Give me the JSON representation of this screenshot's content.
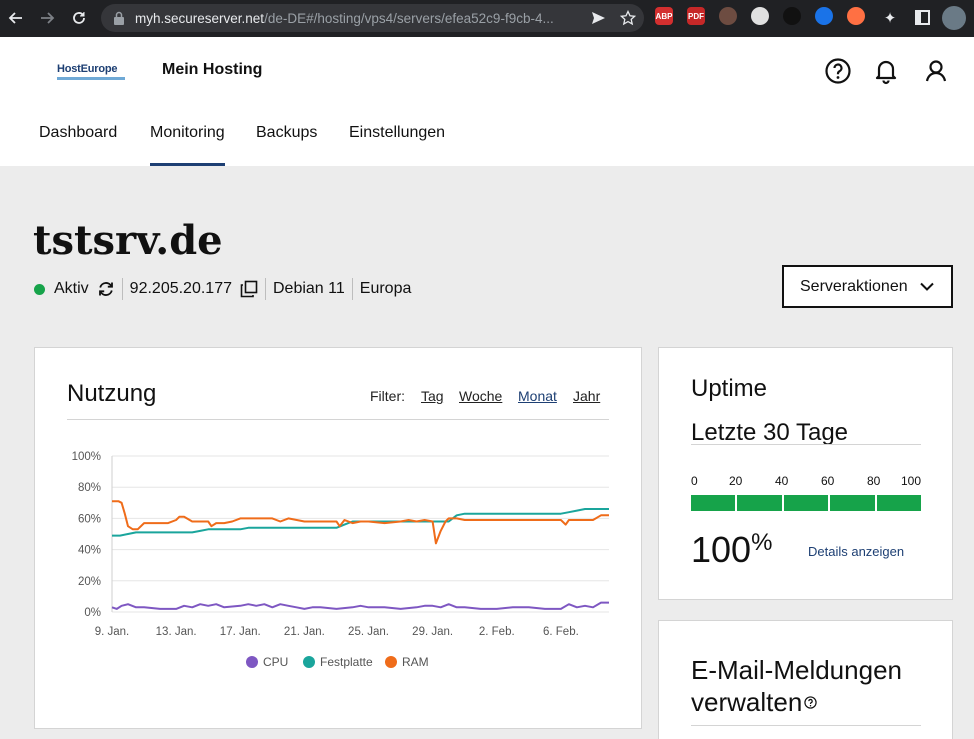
{
  "browser": {
    "url_host": "myh.secureserver.net",
    "url_path": "/de-DE#/hosting/vps4/servers/efea52c9-f9cb-4...",
    "extensions": [
      {
        "name": "abp-extension",
        "label": "ABP",
        "color": "#d32f2f"
      },
      {
        "name": "pdf-extension",
        "label": "PDF",
        "color": "#c62828"
      },
      {
        "name": "coffee-extension",
        "label": "",
        "color": "#6d4c41"
      },
      {
        "name": "media-extension",
        "label": "",
        "color": "#e0e0e0"
      },
      {
        "name": "gnome-extension",
        "label": "",
        "color": "#111111"
      },
      {
        "name": "shield-extension",
        "label": "",
        "color": "#1a73e8"
      },
      {
        "name": "drop-extension",
        "label": "",
        "color": "#ff7043"
      }
    ]
  },
  "header": {
    "logo_text": "HostEurope",
    "site_name": "Mein Hosting",
    "tabs": [
      {
        "label": "Dashboard",
        "active": false
      },
      {
        "label": "Monitoring",
        "active": true
      },
      {
        "label": "Backups",
        "active": false
      },
      {
        "label": "Einstellungen",
        "active": false
      }
    ]
  },
  "server": {
    "name": "tstsrv.de",
    "status": "Aktiv",
    "ip": "92.205.20.177",
    "os": "Debian 11",
    "region": "Europa",
    "actions_label": "Serveraktionen",
    "status_color": "#16a34a"
  },
  "usage": {
    "title": "Nutzung",
    "filter_label": "Filter:",
    "filters": [
      {
        "label": "Tag",
        "active": false
      },
      {
        "label": "Woche",
        "active": false
      },
      {
        "label": "Monat",
        "active": true
      },
      {
        "label": "Jahr",
        "active": false
      }
    ]
  },
  "chart_data": {
    "type": "line",
    "title": "",
    "xlabel": "",
    "ylabel": "",
    "ylim": [
      0,
      100
    ],
    "y_ticks": [
      "0%",
      "20%",
      "40%",
      "60%",
      "80%",
      "100%"
    ],
    "x_ticks": [
      "9. Jan.",
      "13. Jan.",
      "17. Jan.",
      "21. Jan.",
      "25. Jan.",
      "29. Jan.",
      "2. Feb.",
      "6. Feb."
    ],
    "x_tick_days": [
      0,
      4,
      8,
      12,
      16,
      20,
      24,
      28
    ],
    "x_range_days": [
      0,
      31
    ],
    "grid": "horizontal",
    "legend_position": "bottom",
    "series": [
      {
        "name": "CPU",
        "color": "#7e57c2",
        "x": [
          0,
          0.3,
          0.6,
          1,
          1.5,
          2,
          3,
          4,
          4.5,
          5,
          5.5,
          6,
          6.5,
          7,
          8,
          8.5,
          9,
          9.5,
          10,
          10.5,
          11,
          11.5,
          12,
          12.5,
          13,
          14,
          15,
          15.5,
          16,
          17,
          18,
          19,
          19.5,
          20,
          20.5,
          21,
          21.5,
          22,
          23,
          24,
          25,
          26,
          27,
          28,
          28.5,
          29,
          29.5,
          30,
          30.5,
          31
        ],
        "y": [
          3,
          2,
          4,
          5,
          3,
          3,
          2,
          2,
          4,
          3,
          5,
          4,
          5,
          3,
          4,
          5,
          4,
          5,
          3,
          5,
          4,
          3,
          2,
          3,
          3,
          2,
          3,
          4,
          3,
          3,
          2,
          3,
          4,
          4,
          3,
          5,
          3,
          3,
          2,
          2,
          3,
          3,
          2,
          2,
          5,
          3,
          4,
          3,
          6,
          6
        ]
      },
      {
        "name": "Festplatte",
        "color": "#1aa59c",
        "x": [
          0,
          0.5,
          1,
          1.5,
          2,
          4,
          5,
          5.5,
          6,
          7,
          8,
          8.5,
          9,
          14,
          14.5,
          15,
          16,
          18,
          19,
          20,
          21,
          21.5,
          22,
          28,
          28.5,
          29,
          29.5,
          30,
          31
        ],
        "y": [
          49,
          49,
          50,
          51,
          51,
          51,
          51,
          52,
          53,
          53,
          53,
          54,
          54,
          54,
          56,
          58,
          58,
          58,
          58,
          58,
          58,
          62,
          63,
          63,
          64,
          65,
          66,
          66,
          66
        ]
      },
      {
        "name": "RAM",
        "color": "#ef6c1a",
        "x": [
          0,
          0.4,
          0.6,
          0.8,
          1,
          1.3,
          1.6,
          2,
          3,
          3.5,
          4,
          4.2,
          4.5,
          5,
          6,
          6.2,
          6.5,
          7,
          7.5,
          8,
          8.5,
          10,
          10.5,
          11,
          12,
          14,
          14.2,
          14.5,
          15,
          15.5,
          16,
          17,
          18,
          18.5,
          19,
          19.5,
          20,
          20.2,
          20.5,
          20.8,
          21,
          21.5,
          22,
          28,
          28.3,
          28.5,
          29,
          30,
          30.5,
          31
        ],
        "y": [
          71,
          71,
          70,
          63,
          55,
          53,
          53,
          57,
          57,
          57,
          59,
          61,
          61,
          58,
          58,
          55,
          57,
          57,
          58,
          60,
          60,
          60,
          58,
          60,
          58,
          58,
          55,
          59,
          57,
          58,
          58,
          57,
          58,
          59,
          58,
          59,
          58,
          44,
          52,
          58,
          60,
          60,
          59,
          59,
          56,
          59,
          59,
          59,
          62,
          62
        ]
      }
    ]
  },
  "uptime": {
    "title": "Uptime",
    "subtitle": "Letzte 30 Tage",
    "scale": [
      "0",
      "20",
      "40",
      "60",
      "80",
      "100"
    ],
    "value": "100",
    "unit": "%",
    "bar_fill_percent": 100,
    "bar_color": "#16a34a",
    "details_label": "Details anzeigen"
  },
  "email": {
    "title": "E-Mail-Meldungen verwalten"
  }
}
